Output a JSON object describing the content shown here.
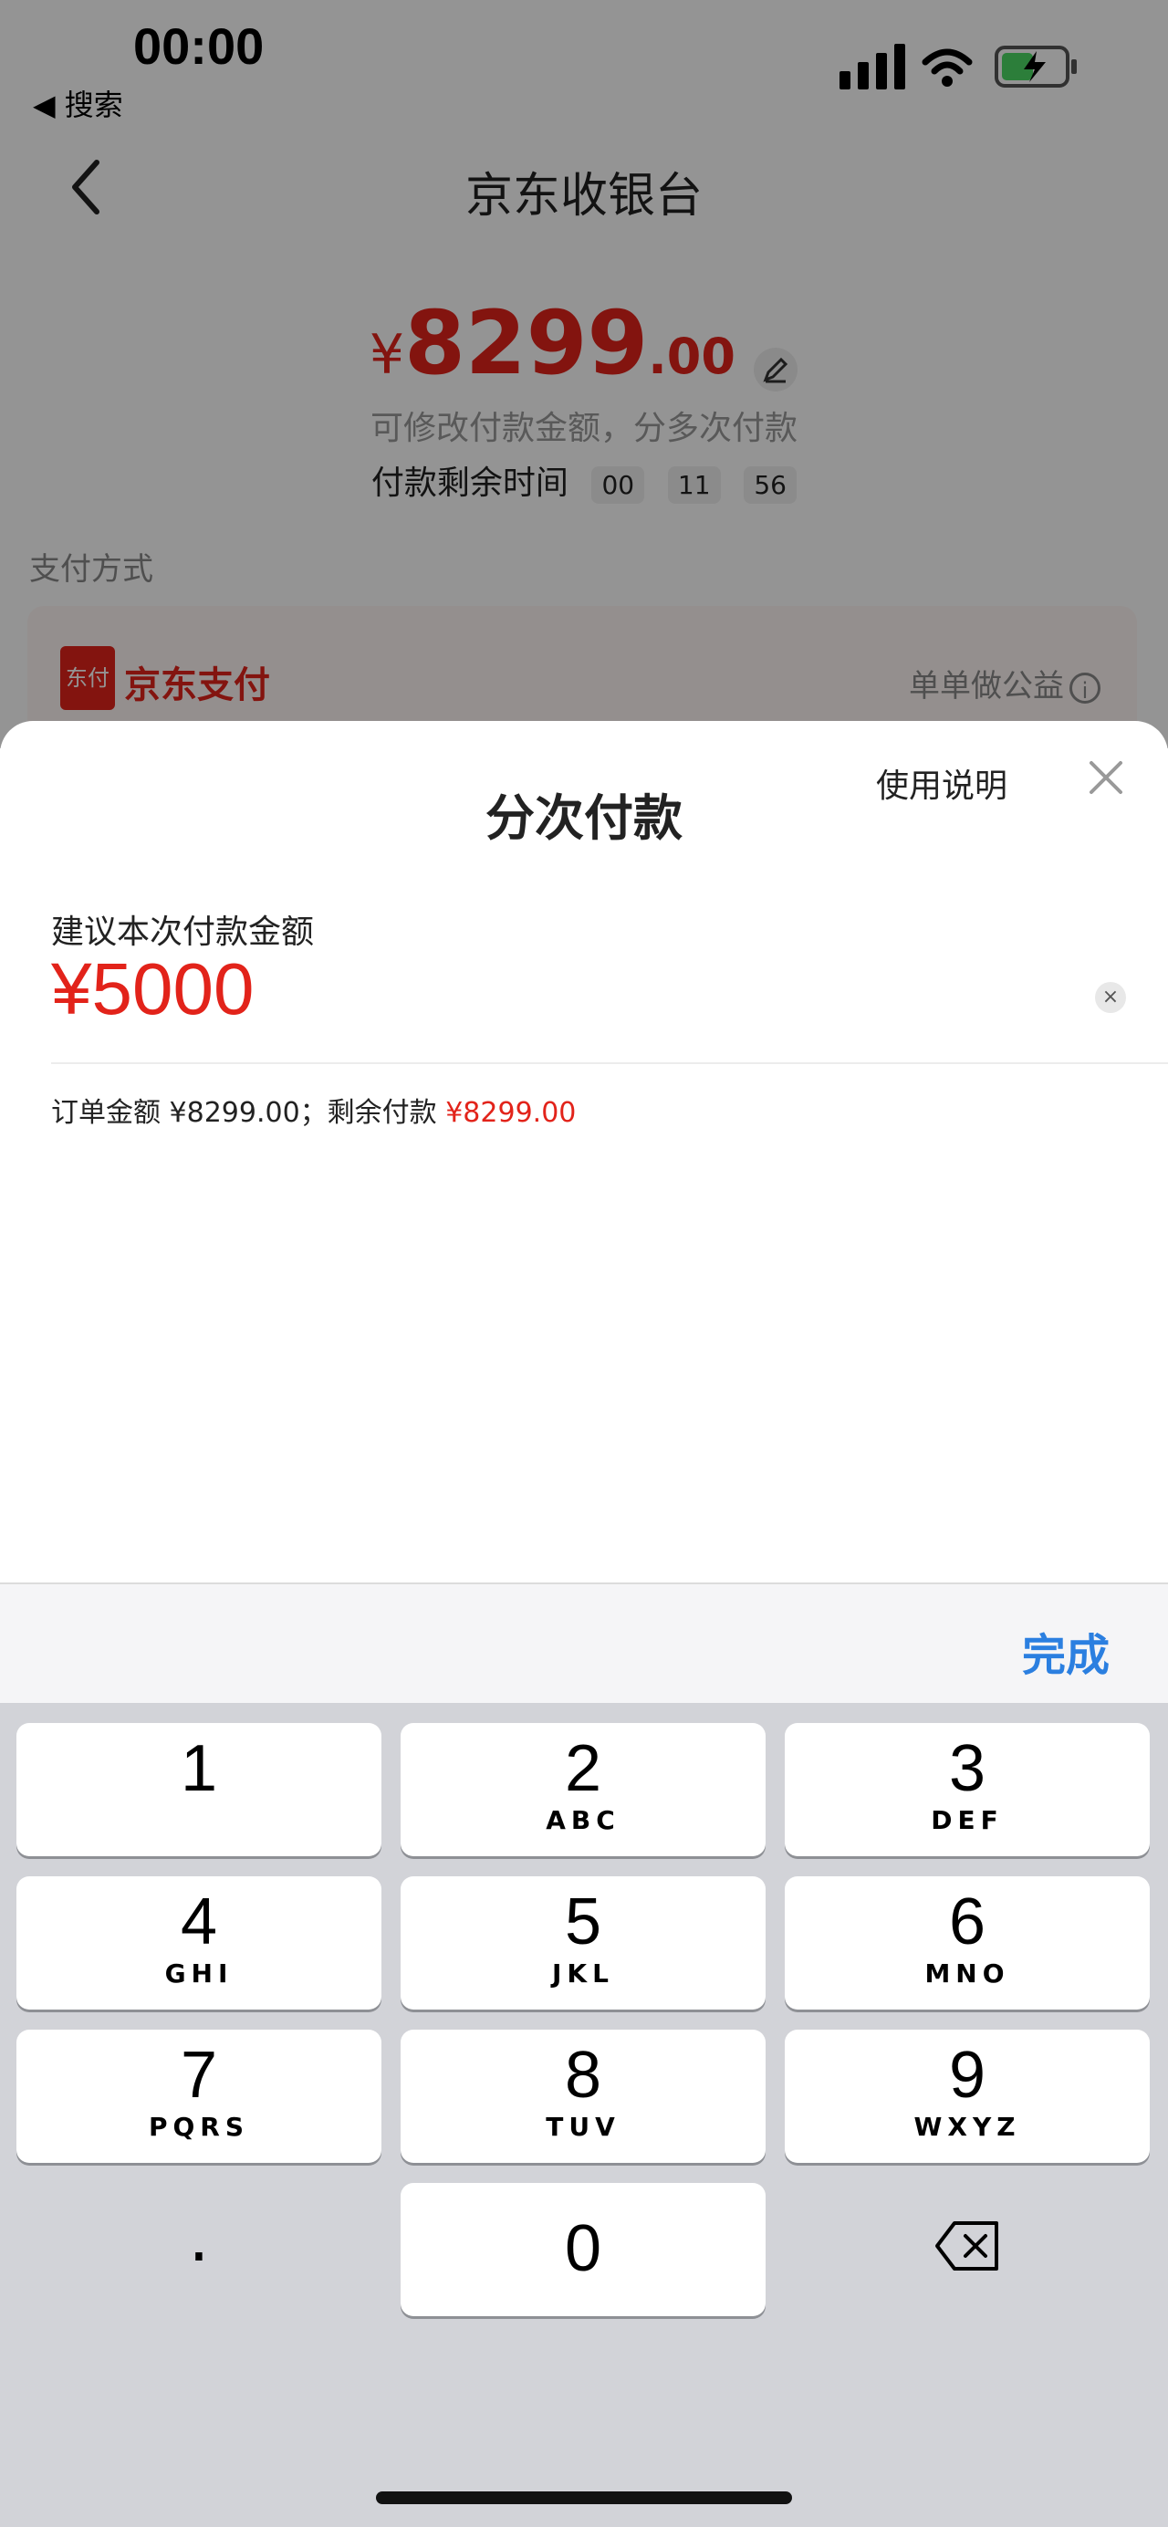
{
  "status_bar": {
    "time": "00:00",
    "back_app": "◀ 搜索"
  },
  "header": {
    "title": "京东收银台"
  },
  "payment": {
    "currency": "¥",
    "amount_int": "8299",
    "amount_dec": ".00",
    "hint": "可修改付款金额，分多次付款",
    "timer_label": "付款剩余时间",
    "timer": [
      "00",
      "11",
      "56"
    ]
  },
  "pay_method": {
    "label": "支付方式",
    "logo_text": "东付",
    "name": "京东支付",
    "charity": "单单做公益",
    "charity_icon": "i"
  },
  "sheet": {
    "title": "分次付款",
    "help": "使用说明",
    "suggest_label": "建议本次付款金额",
    "amount_value": "¥5000",
    "clear_icon": "×",
    "summary_prefix": "订单金额 ¥8299.00；剩余付款 ",
    "summary_remain": "¥8299.00"
  },
  "keyboard": {
    "done": "完成",
    "keys": [
      {
        "num": "1",
        "letters": ""
      },
      {
        "num": "2",
        "letters": "ABC"
      },
      {
        "num": "3",
        "letters": "DEF"
      },
      {
        "num": "4",
        "letters": "GHI"
      },
      {
        "num": "5",
        "letters": "JKL"
      },
      {
        "num": "6",
        "letters": "MNO"
      },
      {
        "num": "7",
        "letters": "PQRS"
      },
      {
        "num": "8",
        "letters": "TUV"
      },
      {
        "num": "9",
        "letters": "WXYZ"
      }
    ],
    "dot": ".",
    "zero": "0"
  },
  "colors": {
    "accent_red": "#e2231a",
    "link_blue": "#2b7fe0"
  }
}
